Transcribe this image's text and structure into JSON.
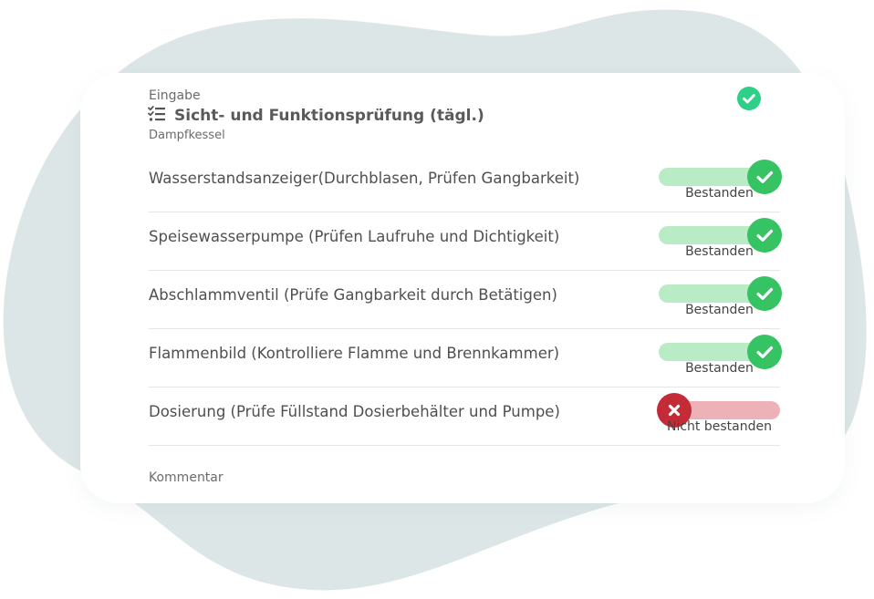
{
  "header": {
    "kicker": "Eingabe",
    "title": "Sicht- und Funktionsprüfung (tägl.)",
    "subtitle": "Dampfkessel",
    "list_icon": "checklist-icon",
    "status_icon": "check-circle-icon"
  },
  "checks": [
    {
      "label": "Wasserstandsanzeiger(Durchblasen, Prüfen Gangbarkeit)",
      "status": "Bestanden",
      "passed": true
    },
    {
      "label": "Speisewasserpumpe (Prüfen Laufruhe und Dichtigkeit)",
      "status": "Bestanden",
      "passed": true
    },
    {
      "label": "Abschlammventil (Prüfe Gangbarkeit durch Betätigen)",
      "status": "Bestanden",
      "passed": true
    },
    {
      "label": "Flammenbild (Kontrolliere Flamme und Brennkammer)",
      "status": "Bestanden",
      "passed": true
    },
    {
      "label": "Dosierung (Prüfe Füllstand Dosierbehälter und Pumpe)",
      "status": "Nicht bestanden",
      "passed": false
    }
  ],
  "comment_label": "Kommentar",
  "colors": {
    "pass_track": "#b9ebc4",
    "pass_knob": "#35c363",
    "fail_track": "#ecb2b7",
    "fail_knob": "#c32b36",
    "header_check": "#2ecf87",
    "background_blob": "#dde6e7"
  }
}
